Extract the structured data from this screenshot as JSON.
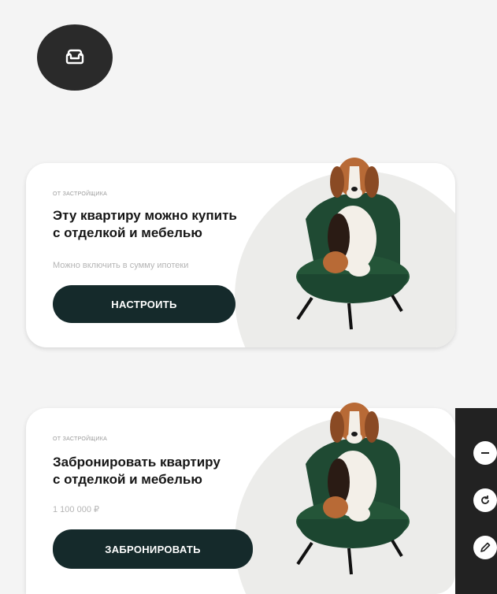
{
  "icons": {
    "avatar": "armchair-icon",
    "tools": [
      "minus-icon",
      "refresh-icon",
      "pencil-icon"
    ]
  },
  "colors": {
    "button": "#152a2b",
    "chair": "#1f4a33",
    "toolbar": "#222222"
  },
  "cards": [
    {
      "eyebrow": "ОТ ЗАСТРОЙЩИКА",
      "title_line1": "Эту квартиру можно купить",
      "title_line2": "с отделкой и мебелью",
      "subtitle": "Можно включить в сумму ипотеки",
      "button": "НАСТРОИТЬ"
    },
    {
      "eyebrow": "ОТ ЗАСТРОЙЩИКА",
      "title_line1": "Забронировать квартиру",
      "title_line2": "с отделкой и мебелью",
      "subtitle": "1 100 000 ₽",
      "button": "ЗАБРОНИРОВАТЬ"
    }
  ]
}
